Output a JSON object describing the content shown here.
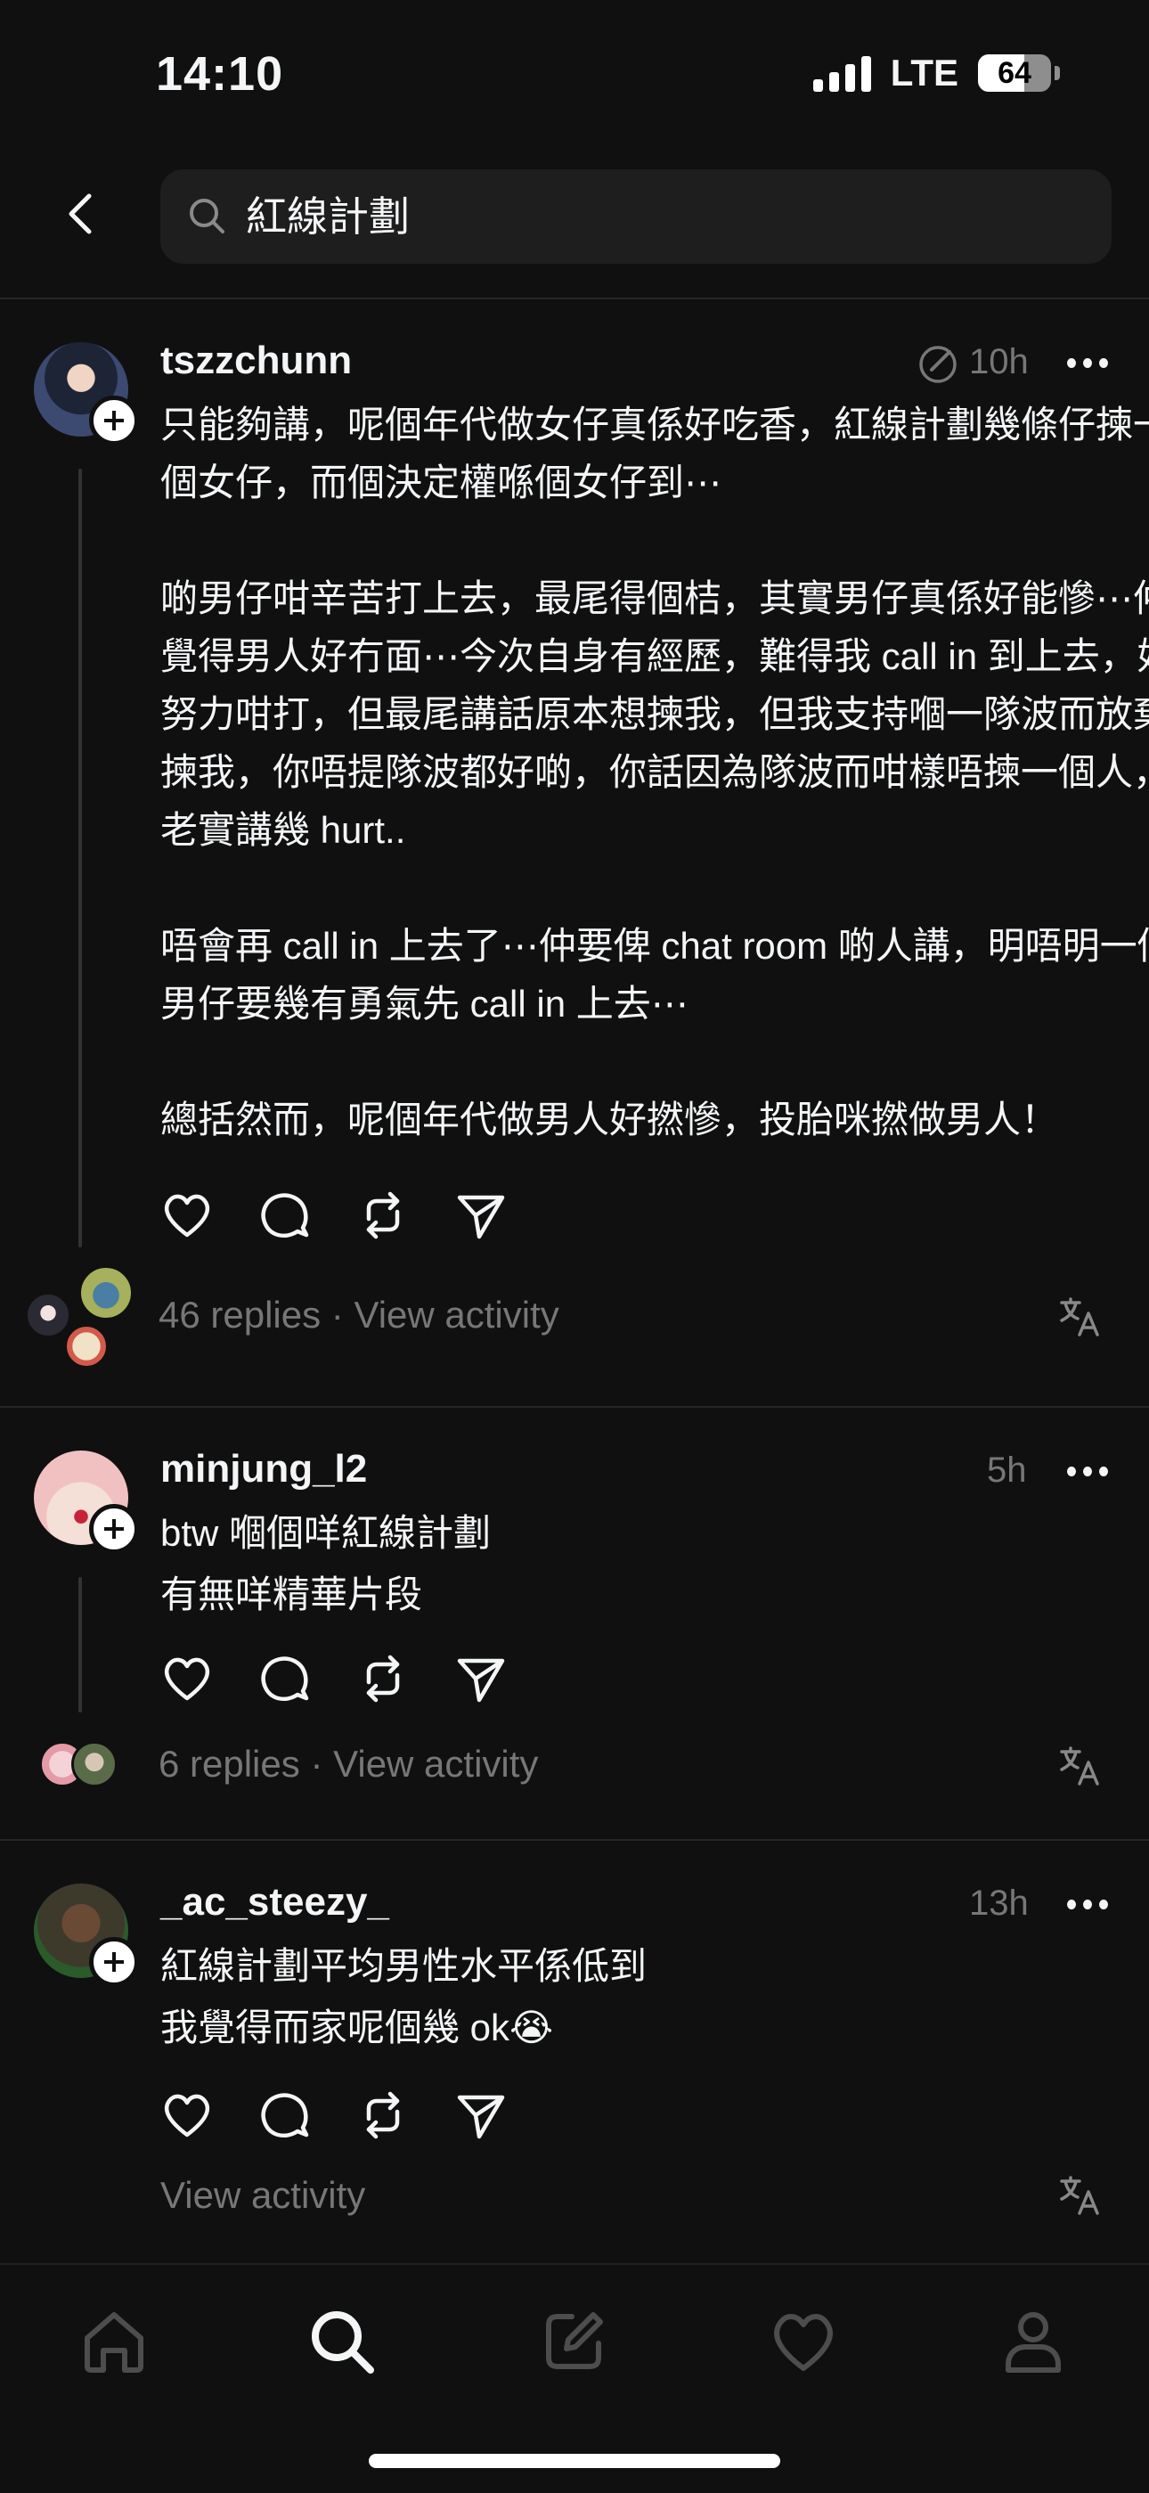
{
  "status": {
    "time": "14:10",
    "network": "LTE",
    "battery": "64",
    "battery_fraction": 0.64
  },
  "search": {
    "query": "紅線計劃"
  },
  "posts": [
    {
      "username": "tszzchunn",
      "time": "10h",
      "paragraphs": [
        "只能夠講，呢個年代做女仔真係好吃香，紅線計劃幾條仔揀一個女仔，而個決定權喺個女仔到⋯",
        "啲男仔咁辛苦打上去，最尾得個桔，其實男仔真係好能慘⋯仲覺得男人好冇面⋯今次自身有經歷，難得我 call in 到上去，好努力咁打，但最尾講話原本想揀我，但我支持嗰一隊波而放棄揀我，你唔提隊波都好啲，你話因為隊波而咁樣唔揀一個人，老實講幾 hurt..",
        "唔會再 call in 上去了⋯仲要俾 chat room 啲人講，明唔明一個男仔要幾有勇氣先 call in 上去⋯",
        "總括然而，呢個年代做男人好撚慘，投胎咪撚做男人！"
      ],
      "replies": "46 replies",
      "activity": "View activity"
    },
    {
      "username": "minjung_l2",
      "time": "5h",
      "paragraphs": [
        "btw 嗰個咩紅線計劃",
        "有無咩精華片段"
      ],
      "replies": "6 replies",
      "activity": "View activity"
    },
    {
      "username": "_ac_steezy_",
      "time": "13h",
      "paragraphs": [
        "紅線計劃平均男性水平係低到",
        "我覺得而家呢個幾 ok😭"
      ],
      "activity": "View activity"
    }
  ],
  "meta_separator": "·",
  "nav": [
    "home-icon",
    "search-icon",
    "compose-icon",
    "heart-icon",
    "profile-icon"
  ]
}
